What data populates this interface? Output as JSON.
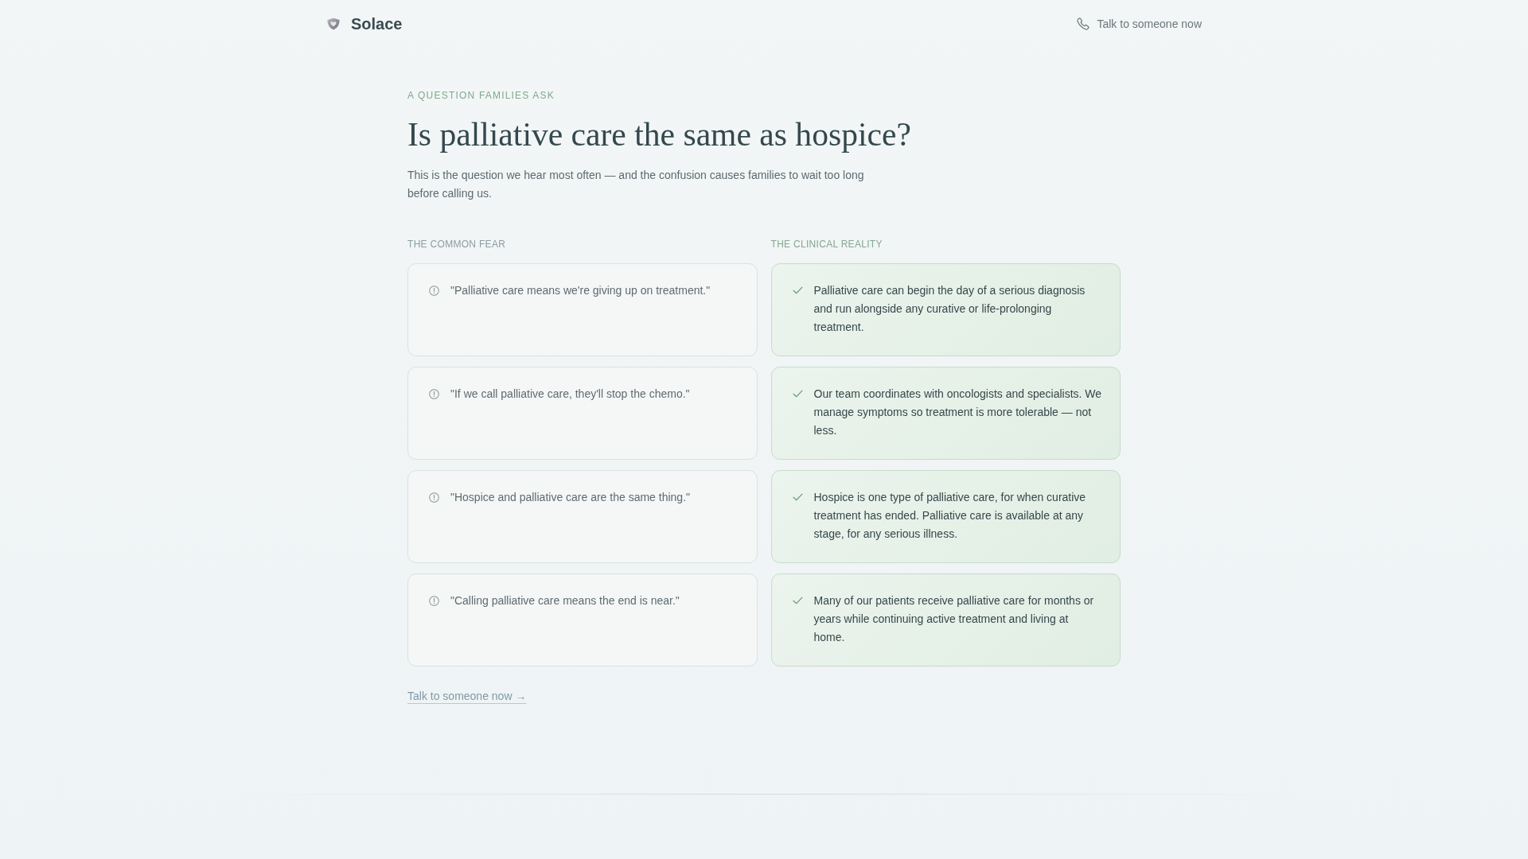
{
  "header": {
    "brand": "Solace",
    "contact_link": "Talk to someone now"
  },
  "intro": {
    "eyebrow": "A QUESTION FAMILIES ASK",
    "title": "Is palliative care the same as hospice?",
    "lead": "This is the question we hear most often — and the confusion causes families to wait too long before calling us."
  },
  "comparison": {
    "fear_heading": "THE COMMON FEAR",
    "reality_heading": "THE CLINICAL REALITY",
    "rows": [
      {
        "fear": "\"Palliative care means we're giving up on treatment.\"",
        "reality": "Palliative care can begin the day of a serious diagnosis and run alongside any curative or life-prolonging treatment."
      },
      {
        "fear": "\"If we call palliative care, they'll stop the chemo.\"",
        "reality": "Our team coordinates with oncologists and specialists. We manage symptoms so treatment is more tolerable — not less."
      },
      {
        "fear": "\"Hospice and palliative care are the same thing.\"",
        "reality": "Hospice is one type of palliative care, for when curative treatment has ended. Palliative care is available at any stage, for any serious illness."
      },
      {
        "fear": "\"Calling palliative care means the end is near.\"",
        "reality": "Many of our patients receive palliative care for months or years while continuing active treatment and living at home."
      }
    ]
  },
  "cta_link": "Talk to someone now →"
}
